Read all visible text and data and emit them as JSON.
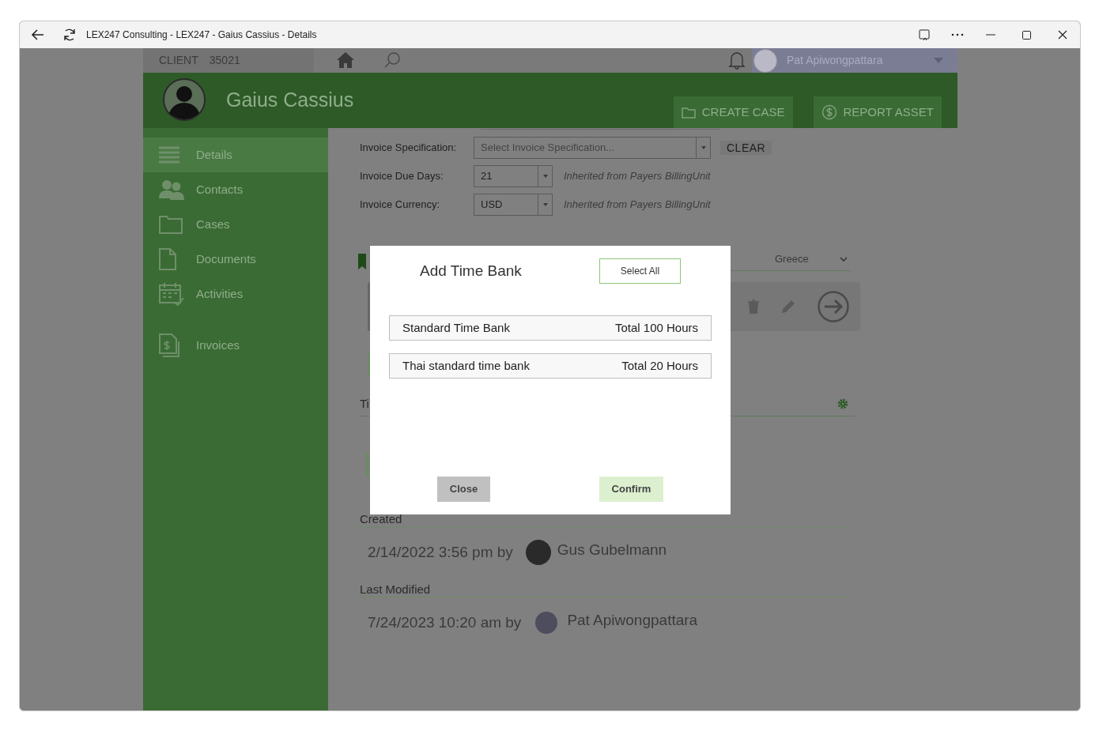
{
  "window": {
    "title": "LEX247 Consulting - LEX247 - Gaius Cassius - Details"
  },
  "topbar": {
    "client_label": "CLIENT",
    "client_number": "35021",
    "user_name": "Pat Apiwongpattara"
  },
  "header": {
    "name": "Gaius Cassius",
    "actions": [
      {
        "label": "CREATE CASE",
        "kind": "folder"
      },
      {
        "label": "REPORT ASSET",
        "kind": "dollar"
      }
    ]
  },
  "sidebar": {
    "items": [
      {
        "label": "Details",
        "kind": "list",
        "selected": true
      },
      {
        "label": "Contacts",
        "kind": "people",
        "selected": false
      },
      {
        "label": "Cases",
        "kind": "folder",
        "selected": false
      },
      {
        "label": "Documents",
        "kind": "document",
        "selected": false
      },
      {
        "label": "Activities",
        "kind": "calendar",
        "selected": false
      },
      {
        "label": "Invoices",
        "kind": "invoice",
        "selected": false
      }
    ]
  },
  "form": {
    "fields": [
      {
        "label": "Invoice Specification:",
        "placeholder": "Select Invoice Specification...",
        "action": "CLEAR"
      },
      {
        "label": "Invoice Due Days:",
        "value": "21",
        "note": "Inherited from Payers BillingUnit"
      },
      {
        "label": "Invoice Currency:",
        "value": "USD",
        "note": "Inherited from Payers BillingUnit"
      }
    ]
  },
  "country_dropdown": {
    "value": "Greece"
  },
  "section_heading": "Ti",
  "created": {
    "heading": "Created",
    "when": "2/14/2022 3:56 pm by",
    "who": "Gus Gubelmann"
  },
  "last_modified": {
    "heading": "Last Modified",
    "when": "7/24/2023 10:20 am by",
    "who": "Pat Apiwongpattara"
  },
  "dialog": {
    "title": "Add Time Bank",
    "select_all": "Select All",
    "banks": [
      {
        "name": "Standard Time Bank",
        "total": "Total 100 Hours"
      },
      {
        "name": "Thai standard time bank",
        "total": "Total 20 Hours"
      }
    ],
    "buttons": [
      {
        "label": "Close",
        "kind": "secondary"
      },
      {
        "label": "Confirm",
        "kind": "primary"
      }
    ]
  }
}
